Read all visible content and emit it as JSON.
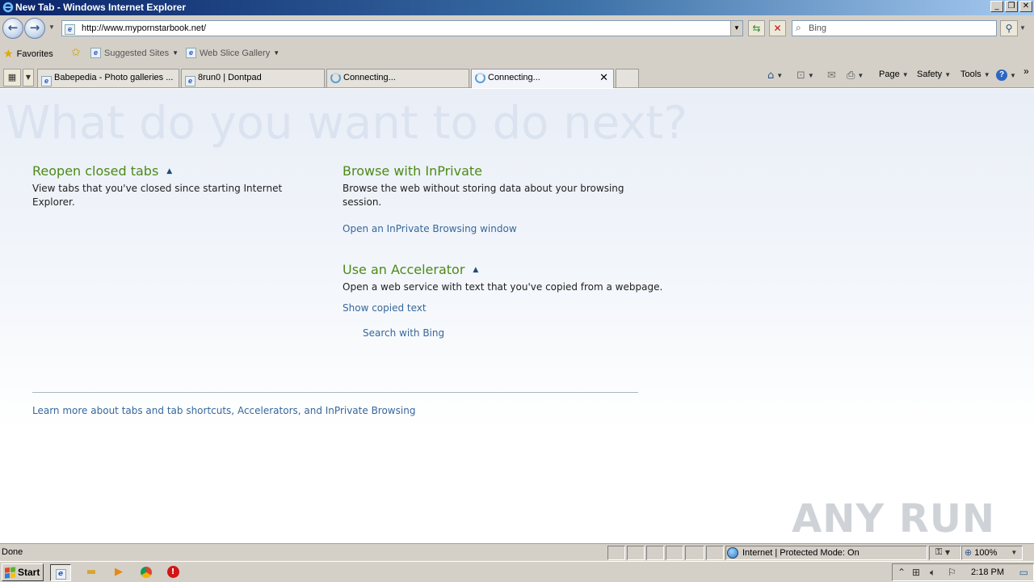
{
  "window": {
    "title": "New Tab - Windows Internet Explorer",
    "minimize": "_",
    "restore": "❐",
    "close": "✕"
  },
  "address_bar": {
    "url": "http://www.mypornstarbook.net/",
    "search_placeholder": "Bing"
  },
  "favorites_bar": {
    "favorites_label": "Favorites",
    "suggested_sites_label": "Suggested Sites",
    "web_slice_gallery_label": "Web Slice Gallery"
  },
  "tabs": [
    {
      "label": "Babepedia - Photo galleries ...",
      "state": "loaded"
    },
    {
      "label": "8run0 | Dontpad",
      "state": "loaded"
    },
    {
      "label": "Connecting...",
      "state": "loading"
    },
    {
      "label": "Connecting...",
      "state": "loading",
      "active": true
    }
  ],
  "command_bar": {
    "page_label": "Page",
    "safety_label": "Safety",
    "tools_label": "Tools",
    "help_glyph": "?"
  },
  "content": {
    "heading": "What do you want to do next?",
    "reopen": {
      "title": "Reopen closed tabs",
      "text": "View tabs that you've closed since starting Internet Explorer."
    },
    "inprivate": {
      "title": "Browse with InPrivate",
      "text_line1": "Browse the web without storing data about your browsing",
      "text_line2": "session.",
      "link": "Open an InPrivate Browsing window"
    },
    "accelerator": {
      "title": "Use an Accelerator",
      "text": "Open a web service with text that you've copied from a webpage.",
      "link_show": "Show copied text",
      "link_search": "Search with Bing"
    },
    "learn_more": "Learn more about tabs and tab shortcuts, Accelerators, and InPrivate Browsing",
    "watermark": "ANY RUN"
  },
  "status_bar": {
    "status": "Done",
    "zone": "Internet | Protected Mode: On",
    "zoom": "100%"
  },
  "taskbar": {
    "start_label": "Start",
    "clock": "2:18 PM"
  },
  "colors": {
    "section_title": "#4d8a17",
    "link": "#36679c",
    "heading_faded": "#dbe3f0"
  }
}
